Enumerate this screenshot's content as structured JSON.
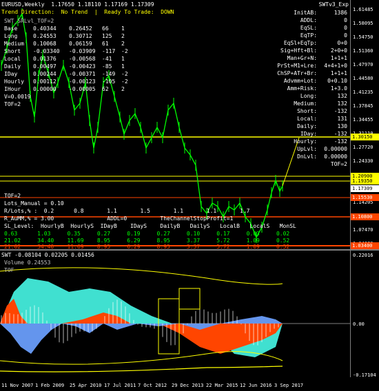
{
  "header": {
    "symbol_line": "EURUSD,Weekly  1.17650 1.18110 1.17169 1.17309",
    "expert_name": "SWTv3_Exp",
    "trend_line": "Trend Direction:  No Trend  |  Ready To Trade:  DOWN",
    "overlay_title": "SWT_SRLvl_TOF=2"
  },
  "left_table": {
    "rows": [
      {
        "name": "Base",
        "a": "0.40344",
        "b": "0.26452",
        "c": "66",
        "d": "1"
      },
      {
        "name": "Long",
        "a": "0.24553",
        "b": "0.30712",
        "c": "125",
        "d": "2"
      },
      {
        "name": "Medium",
        "a": "0.10068",
        "b": "0.06159",
        "c": "61",
        "d": "2"
      },
      {
        "name": "Short",
        "a": "-0.03340",
        "b": "-0.03909",
        "c": "-117",
        "d": "-2"
      },
      {
        "name": "Local",
        "a": "0.01376",
        "b": "-0.00568",
        "c": "-41",
        "d": "1"
      },
      {
        "name": "Daily",
        "a": "0.00497",
        "b": "-0.00423",
        "c": "-85",
        "d": "1"
      },
      {
        "name": "IDay",
        "a": "0.00244",
        "b": "-0.00371",
        "c": "-149",
        "d": "-2"
      },
      {
        "name": "Hourly",
        "a": "0.00112",
        "b": "-0.00123",
        "c": "-105",
        "d": "-2"
      },
      {
        "name": "IHour",
        "a": "0.00000",
        "b": "-0.00005",
        "c": "62",
        "d": "2"
      }
    ],
    "v_line": "V=0.0019",
    "tof_line": "TOF=2"
  },
  "right_table": {
    "rows": [
      {
        "label": "InitAB:",
        "value": "1386"
      },
      {
        "label": "ADDL:",
        "value": "0"
      },
      {
        "label": "EqSL:",
        "value": "0"
      },
      {
        "label": "EqTP:",
        "value": "0"
      },
      {
        "label": "EqSl+EqTp:",
        "value": "0+0"
      },
      {
        "label": "Sig+Hft+Bl:",
        "value": "2+0+0"
      },
      {
        "label": "Man+Gr+N:",
        "value": "1+1+1"
      },
      {
        "label": "PrSt+M1+Lre:",
        "value": "4+4+1+0"
      },
      {
        "label": "ChSP+ATr+Br:",
        "value": "1+1+1"
      },
      {
        "label": "Advmm+Lot:",
        "value": "0+0.10"
      },
      {
        "label": "Amm+Risk:",
        "value": "1+3.0"
      },
      {
        "label": "Long:",
        "value": "132"
      },
      {
        "label": "Medium:",
        "value": "132"
      },
      {
        "label": "Short:",
        "value": "-132"
      },
      {
        "label": "Local:",
        "value": "131"
      },
      {
        "label": "Daily:",
        "value": "130"
      },
      {
        "label": "IDay:",
        "value": "-132"
      },
      {
        "label": "Hourly:",
        "value": "-132"
      },
      {
        "label": "UpLvl:",
        "value": "0.00000"
      },
      {
        "label": "DnLvl:",
        "value": "0.00000"
      },
      {
        "label": "",
        "value": "TOF=2"
      }
    ]
  },
  "bottom_table": {
    "tof": "TOF=2",
    "lots_manual": "Lots_Manual = 0.10",
    "r_lots": "R/Lots,% :  0.2      0.8       1.1       1.5       1.1       1.1       1.7",
    "r_aumm": "R_AuMM,% = 3.00                ADDL=0          TheChannelStopProfit=1",
    "sl_header": "SL_Level:  HourlyB  HourlyS  IDayB    IDayS    DailyB   DailyS   LocalB   LocalS   MonSL",
    "row1": "0.63      1.03     0.35     0.27     0.19     0.27     0.10     0.17     0.03     0.02",
    "row2": "21.02     34.40    11.69    8.95     6.29     8.95     3.37     5.72     1.09     0.52",
    "row3": "21.02     34.40    11.69    8.95     6.29     8.95     3.37     5.72     1.09     0.52"
  },
  "price_axis": {
    "ticks": [
      "1.61485",
      "1.58095",
      "1.54750",
      "1.51360",
      "1.47970",
      "1.44580",
      "1.41235",
      "1.37845",
      "1.34455",
      "1.31110",
      "1.27720",
      "1.24330",
      "1.20985",
      "1.17595",
      "1.14205",
      "1.10860",
      "1.07470",
      "1.04080"
    ],
    "labels": [
      {
        "text": "1.30150",
        "bg": "#ffff00",
        "fg": "#000000"
      },
      {
        "text": "1.20900",
        "bg": "#ffff00",
        "fg": "#000000"
      },
      {
        "text": "1.19350",
        "bg": "#ffff00",
        "fg": "#000000"
      },
      {
        "text": "1.17309",
        "bg": "#ffffff",
        "fg": "#000000"
      },
      {
        "text": "1.15530",
        "bg": "#ff4500",
        "fg": "#ffffff"
      },
      {
        "text": "1.10800",
        "bg": "#ff4500",
        "fg": "#ffffff"
      },
      {
        "text": "1.03400",
        "bg": "#ff4500",
        "fg": "#ffffff"
      }
    ]
  },
  "sub_window": {
    "title": "SWT -0.08104 0.02205 0.01456",
    "volume": "Volume 0.24553",
    "tof": "TOF",
    "ticks": [
      "0.22016",
      "0.00",
      "-0.17104"
    ]
  },
  "x_axis": {
    "labels": [
      "11 Nov 2007",
      "1 Feb 2009",
      "25 Apr 2010",
      "17 Jul 2011",
      "7 Oct 2012",
      "29 Dec 2013",
      "22 Mar 2015",
      "12 Jun 2016",
      "3 Sep 2017"
    ]
  },
  "colors": {
    "price_line": "#00ff00",
    "support": "#ff4500",
    "resistance": "#ffff00",
    "area_cyan": "#40e0d0",
    "area_orange": "#ff4500",
    "area_blue": "#6495ed"
  }
}
